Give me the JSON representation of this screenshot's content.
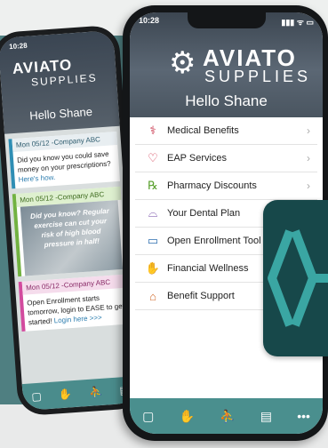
{
  "back_phone": {
    "status_time": "10:28",
    "logo_word": "AVIATO",
    "logo_sub": "SUPPLIES",
    "greeting": "Hello Shane",
    "cards": [
      {
        "header": "Mon 05/12 -Company ABC",
        "body": "Did you know you could save money on your prescriptions?",
        "link": "Here's how."
      },
      {
        "header": "Mon 05/12 -Company ABC",
        "image_text": "Did you know? Regular exercise can cut your risk of high blood pressure in half!"
      },
      {
        "header": "Mon 05/12 -Company ABC",
        "body": "Open Enrollment starts tomorrow, login to EASE to get started!",
        "link": "Login here >>>"
      }
    ]
  },
  "front_phone": {
    "status_time": "10:28",
    "status_icons": "▮▮▮ ᯤ ▭",
    "logo_word": "AVIATO",
    "logo_sub": "SUPPLIES",
    "greeting": "Hello Shane",
    "menu": [
      {
        "label": "Medical Benefits",
        "icon": "stethoscope-icon",
        "glyph": "⚕",
        "color": "#c8334a",
        "chevron": true
      },
      {
        "label": "EAP Services",
        "icon": "heart-icon",
        "glyph": "♡",
        "color": "#d0344c",
        "chevron": true
      },
      {
        "label": "Pharmacy Discounts",
        "icon": "rx-icon",
        "glyph": "℞",
        "color": "#5aa12f",
        "chevron": true
      },
      {
        "label": "Your Dental Plan",
        "icon": "tooth-icon",
        "glyph": "⌓",
        "color": "#6b3fa0",
        "chevron": false
      },
      {
        "label": "Open Enrollment Tool",
        "icon": "laptop-icon",
        "glyph": "▭",
        "color": "#2f6fb0",
        "chevron": false
      },
      {
        "label": "Financial Wellness",
        "icon": "hand-coins-icon",
        "glyph": "✋",
        "color": "#4e9a37",
        "chevron": false
      },
      {
        "label": "Benefit Support",
        "icon": "house-icon",
        "glyph": "⌂",
        "color": "#d0692a",
        "chevron": false
      }
    ],
    "tabbar": [
      "chat-icon",
      "hand-icon",
      "runner-icon",
      "card-icon",
      "more-icon"
    ],
    "tabbar_glyphs": [
      "▢",
      "✋",
      "⛹",
      "▤",
      "•••"
    ]
  }
}
